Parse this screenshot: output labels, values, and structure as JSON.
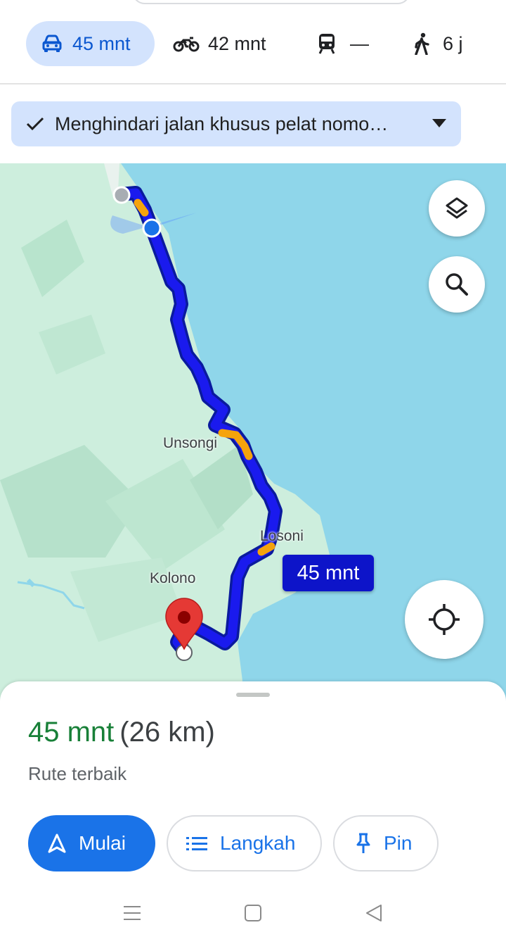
{
  "modes": {
    "car": {
      "label": "45 mnt",
      "icon": "car-icon"
    },
    "motorcycle": {
      "label": "42 mnt",
      "icon": "motorcycle-icon"
    },
    "transit": {
      "label": "—",
      "icon": "train-icon"
    },
    "walk": {
      "label": "6 j",
      "icon": "walk-icon"
    }
  },
  "filter": {
    "label": "Menghindari jalan khusus pelat nomo…",
    "icon": "check-icon"
  },
  "map": {
    "places": [
      "Unsongi",
      "Losoni",
      "Kolono"
    ],
    "eta_label": "45 mnt",
    "colors": {
      "water": "#8fd6ea",
      "land": "#cdeedd",
      "route": "#1a1aee",
      "traffic": "#f5a30c",
      "destination": "#e53935"
    }
  },
  "sheet": {
    "duration": "45 mnt",
    "distance": "(26 km)",
    "subtitle": "Rute terbaik",
    "buttons": {
      "start": "Mulai",
      "steps": "Langkah",
      "pin": "Pin"
    }
  },
  "colors": {
    "accent": "#1a73e8",
    "chip": "#d3e3fd",
    "good": "#188038"
  }
}
